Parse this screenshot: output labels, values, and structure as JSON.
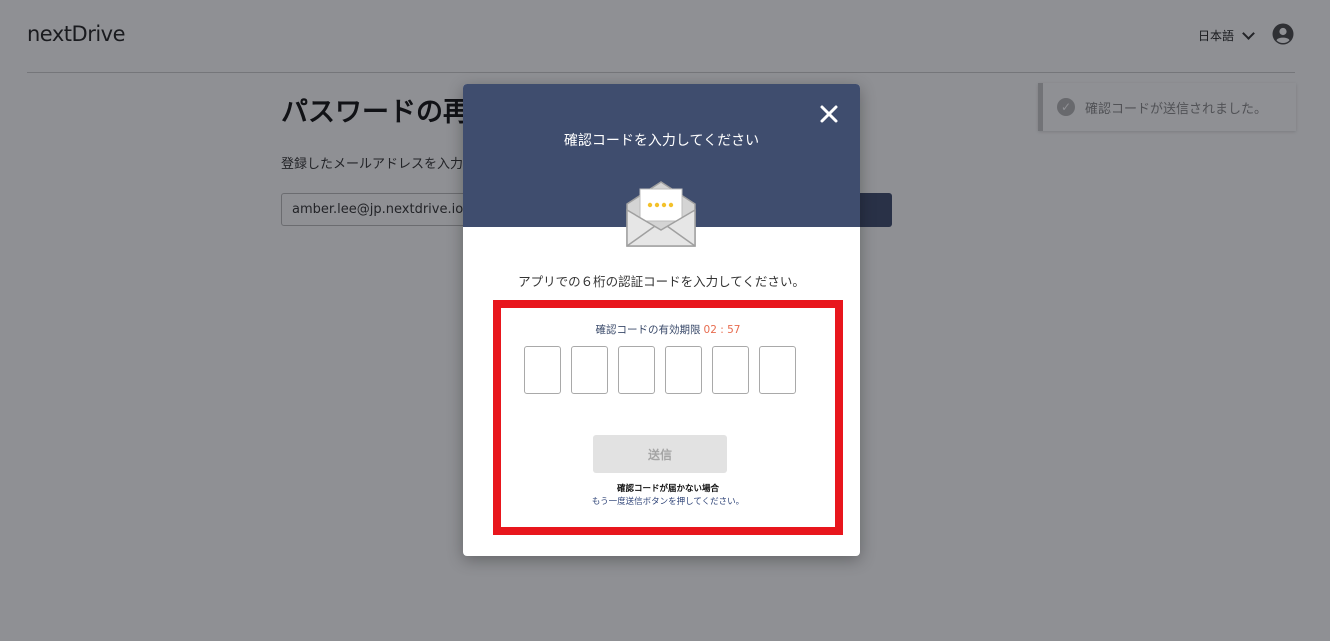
{
  "header": {
    "logo": "nextDrive",
    "language": "日本語",
    "account_icon": "account-circle-icon"
  },
  "background_page": {
    "title": "パスワードの再",
    "description": "登録したメールアドレスを入力し",
    "email_value": "amber.lee@jp.nextdrive.io"
  },
  "toast": {
    "icon": "check-circle-icon",
    "message": "確認コードが送信されました。"
  },
  "modal": {
    "title": "確認コードを入力してください",
    "close_icon": "close-icon",
    "envelope_icon": "envelope-open-icon",
    "instruction": "アプリでの６桁の認証コードを入力してください。",
    "expiry_label": "確認コードの有効期限",
    "expiry_timer": "02 : 57",
    "code_inputs": [
      "",
      "",
      "",
      "",
      "",
      ""
    ],
    "send_button": "送信",
    "resend_title": "確認コードが届かない場合",
    "resend_desc": "もう一度送信ボタンを押してください。"
  },
  "colors": {
    "modal_header": "#3f4d6e",
    "highlight": "#e8161d",
    "timer": "#e76c4f"
  }
}
